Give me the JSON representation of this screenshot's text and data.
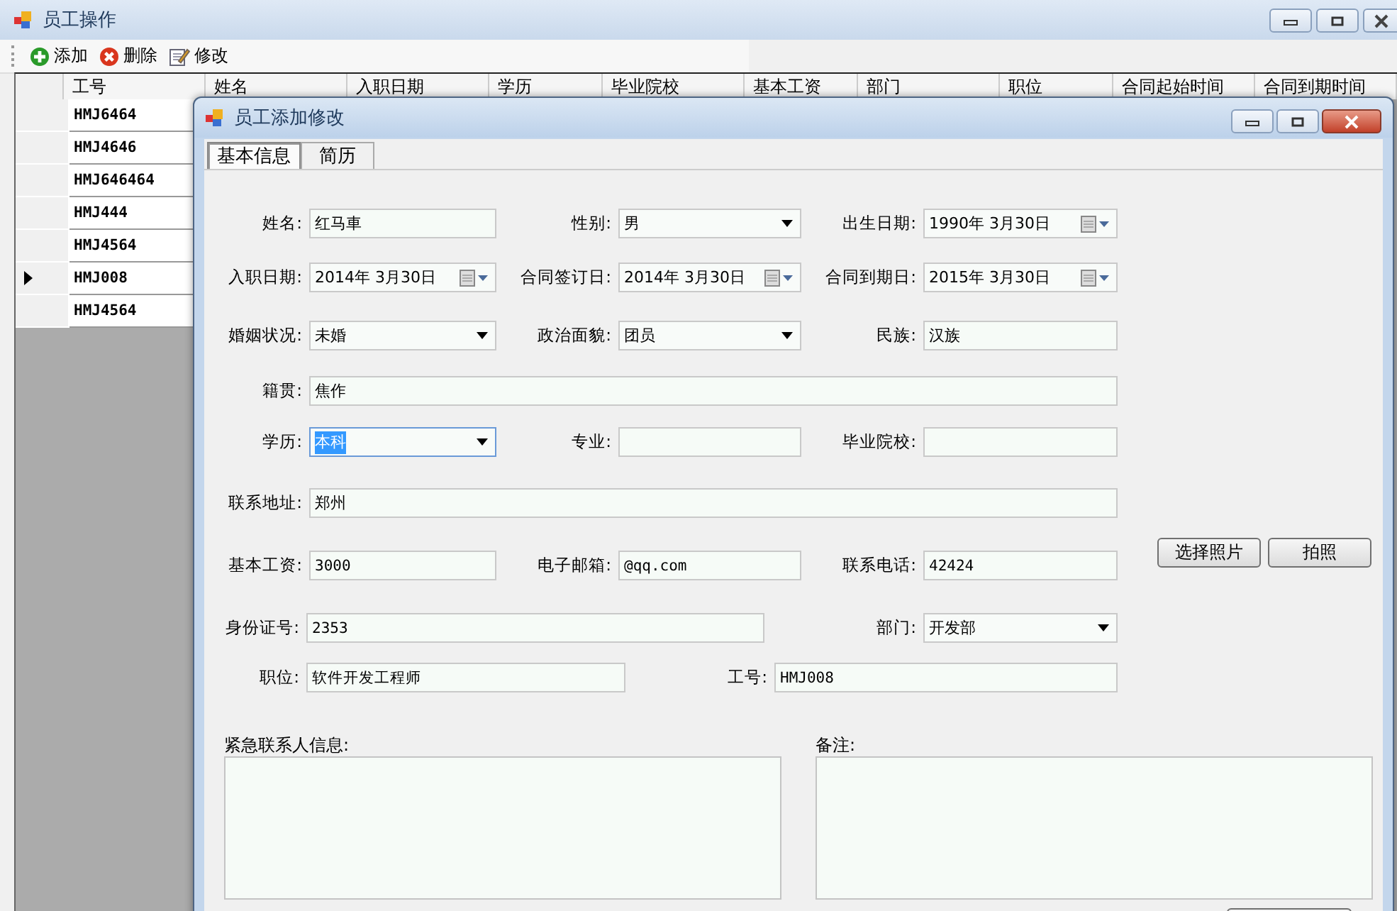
{
  "main_window": {
    "title": "员工操作",
    "toolbar": [
      {
        "label": "添加",
        "kind": "add"
      },
      {
        "label": "删除",
        "kind": "delete"
      },
      {
        "label": "修改",
        "kind": "edit"
      }
    ],
    "table": {
      "columns": [
        "工号",
        "姓名",
        "入职日期",
        "学历",
        "毕业院校",
        "基本工资",
        "部门",
        "职位",
        "合同起始时间",
        "合同到期时间"
      ],
      "rows": [
        {
          "id": "HMJ6464",
          "selected": false
        },
        {
          "id": "HMJ4646",
          "selected": false
        },
        {
          "id": "HMJ646464",
          "selected": false
        },
        {
          "id": "HMJ444",
          "selected": false
        },
        {
          "id": "HMJ4564",
          "selected": false
        },
        {
          "id": "HMJ008",
          "selected": true
        },
        {
          "id": "HMJ4564",
          "selected": false
        }
      ]
    }
  },
  "dialog": {
    "title": "员工添加修改",
    "tabs": [
      {
        "label": "基本信息",
        "selected": true
      },
      {
        "label": "简历",
        "selected": false
      }
    ],
    "form_rows": [
      [
        {
          "label": "姓名:",
          "kind": "text",
          "value": "红马車"
        },
        {
          "label": "性别:",
          "kind": "combo",
          "value": "男",
          "focused": false
        },
        {
          "label": "出生日期:",
          "kind": "date",
          "value": "1990年 3月30日"
        }
      ],
      [
        {
          "label": "入职日期:",
          "kind": "date",
          "value": "2014年 3月30日"
        },
        {
          "label": "合同签订日:",
          "kind": "date",
          "value": "2014年 3月30日"
        },
        {
          "label": "合同到期日:",
          "kind": "date",
          "value": "2015年 3月30日"
        }
      ],
      [
        {
          "label": "婚姻状况:",
          "kind": "combo",
          "value": "未婚",
          "focused": false
        },
        {
          "label": "政治面貌:",
          "kind": "combo",
          "value": "团员",
          "focused": false
        },
        {
          "label": "民族:",
          "kind": "text",
          "value": "汉族"
        }
      ],
      [
        {
          "label": "籍贯:",
          "kind": "text",
          "value": "焦作"
        }
      ],
      [
        {
          "label": "学历:",
          "kind": "combo",
          "value": "本科",
          "focused": true
        },
        {
          "label": "专业:",
          "kind": "text"
        },
        {
          "label": "毕业院校:",
          "kind": "text"
        }
      ],
      [
        {
          "label": "联系地址:",
          "kind": "text",
          "value": "郑州"
        }
      ],
      [
        {
          "label": "基本工资:",
          "kind": "text",
          "value": "3000"
        },
        {
          "label": "电子邮箱:",
          "kind": "text",
          "value": "@qq.com"
        },
        {
          "label": "联系电话:",
          "kind": "text",
          "value": "42424"
        }
      ],
      [
        {
          "label": "身份证号:",
          "kind": "text",
          "value": "2353"
        },
        {
          "label": "部门:",
          "kind": "combo",
          "value": "开发部",
          "focused": false
        }
      ],
      [
        {
          "label": "职位:",
          "kind": "text",
          "value": "软件开发工程师"
        },
        {
          "label": "工号:",
          "kind": "text",
          "value": "HMJ008"
        }
      ]
    ],
    "photo_buttons": [
      "选择照片",
      "拍照"
    ],
    "notes": [
      {
        "label": "紧急联系人信息:"
      },
      {
        "label": "备注:"
      }
    ]
  }
}
